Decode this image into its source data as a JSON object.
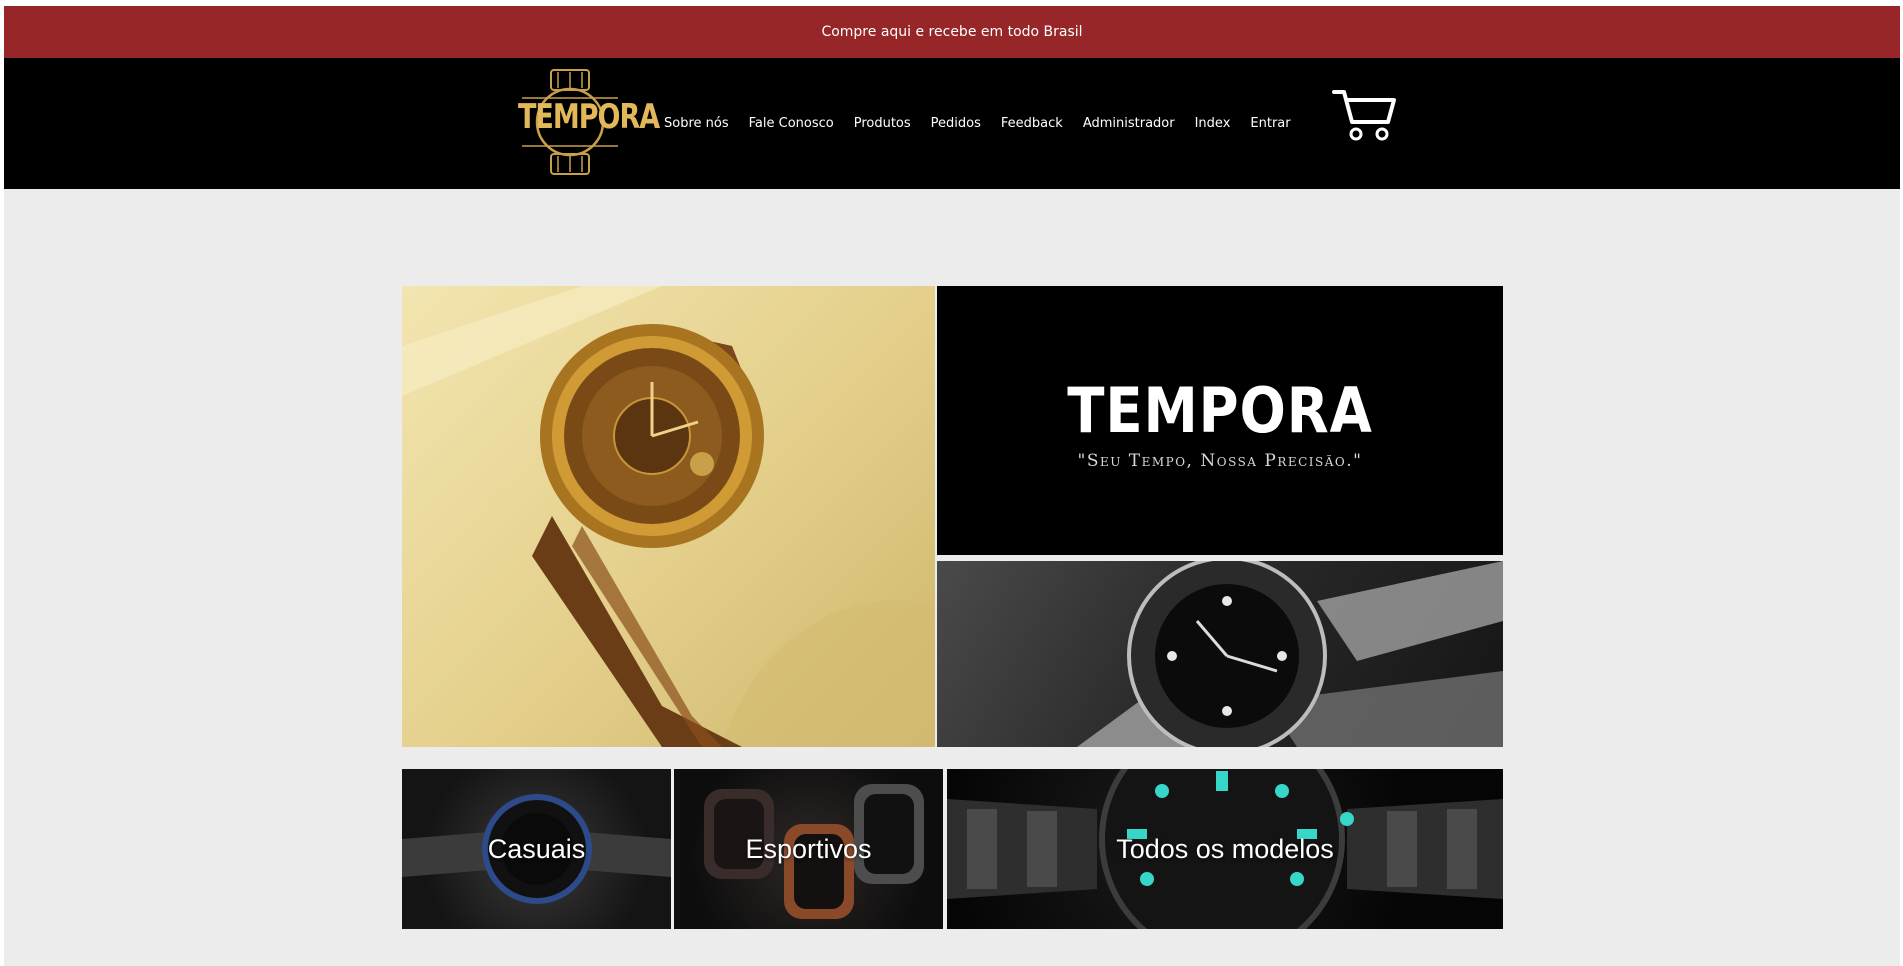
{
  "banner": {
    "text": "Compre aqui e recebe em todo Brasil"
  },
  "header": {
    "logo_text": "TEMPORA",
    "logo_icon": "watch-logo-icon",
    "cart_icon": "cart-icon",
    "nav": [
      {
        "label": "Sobre nós"
      },
      {
        "label": "Fale Conosco"
      },
      {
        "label": "Produtos"
      },
      {
        "label": "Pedidos"
      },
      {
        "label": "Feedback"
      },
      {
        "label": "Administrador"
      },
      {
        "label": "Index"
      },
      {
        "label": "Entrar"
      }
    ]
  },
  "hero": {
    "brand_title": "TEMPORA",
    "brand_tagline": "\"Seu Tempo, Nossa Precisão.\""
  },
  "categories": [
    {
      "label": "Casuais"
    },
    {
      "label": "Esportivos"
    },
    {
      "label": "Todos os modelos"
    }
  ],
  "colors": {
    "banner": "#962628",
    "header": "#000000",
    "page_bg": "#ececec",
    "logo_gold": "#e2b85a"
  }
}
